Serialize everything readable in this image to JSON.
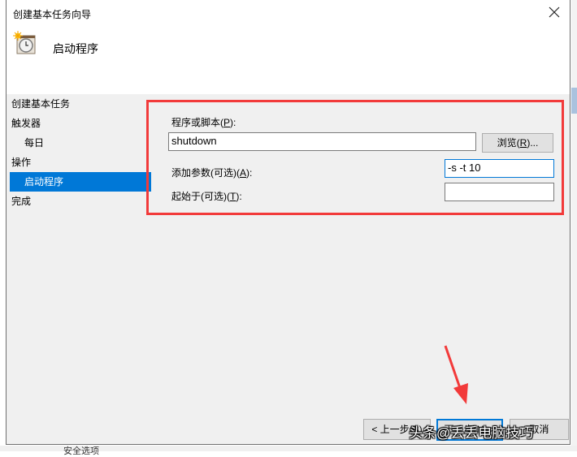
{
  "window": {
    "title": "创建基本任务向导",
    "heading": "启动程序",
    "close_icon": "close-icon",
    "header_icon": "clock-with-sun-icon"
  },
  "nav": {
    "items": [
      {
        "label": "创建基本任务",
        "level": 0,
        "active": false
      },
      {
        "label": "触发器",
        "level": 0,
        "active": false
      },
      {
        "label": "每日",
        "level": 1,
        "active": false
      },
      {
        "label": "操作",
        "level": 0,
        "active": false
      },
      {
        "label": "启动程序",
        "level": 1,
        "active": true
      },
      {
        "label": "完成",
        "level": 0,
        "active": false
      }
    ]
  },
  "form": {
    "program_label": "程序或脚本(",
    "program_key": "P",
    "program_suffix": "):",
    "program_value": "shutdown",
    "browse_label": "浏览(",
    "browse_key": "R",
    "browse_suffix": ")...",
    "args_label": "添加参数(可选)(",
    "args_key": "A",
    "args_suffix": "):",
    "args_value": "-s -t 10",
    "startin_label": "起始于(可选)(",
    "startin_key": "T",
    "startin_suffix": "):",
    "startin_value": ""
  },
  "footer": {
    "back_label": "< 上一步(B)",
    "next_label": "下一步(N) >",
    "cancel_label": "取消"
  },
  "background": {
    "fragment": "安全选项"
  },
  "annotations": {
    "highlight_color": "#f23a3a",
    "arrow_color": "#f23a3a",
    "watermark": "头条@丢丢电脑技巧"
  }
}
